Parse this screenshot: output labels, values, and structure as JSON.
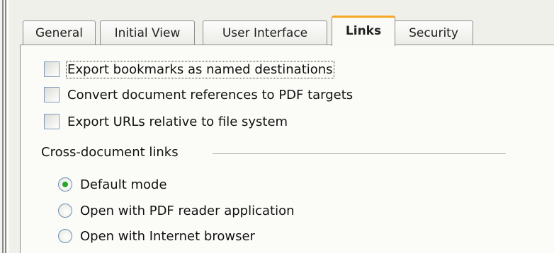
{
  "tabs": [
    {
      "label": "General",
      "active": false
    },
    {
      "label": "Initial View",
      "active": false
    },
    {
      "label": "User Interface",
      "active": false
    },
    {
      "label": "Links",
      "active": true
    },
    {
      "label": "Security",
      "active": false
    }
  ],
  "options": [
    {
      "label": "Export bookmarks as named destinations",
      "checked": false,
      "focused": true
    },
    {
      "label": "Convert document references to PDF targets",
      "checked": false
    },
    {
      "label": "Export URLs relative to file system",
      "checked": false
    }
  ],
  "cross_document_links": {
    "title": "Cross-document links",
    "choices": [
      {
        "label": "Default mode",
        "selected": true
      },
      {
        "label": "Open with PDF reader application",
        "selected": false
      },
      {
        "label": "Open with Internet browser",
        "selected": false
      }
    ]
  },
  "colors": {
    "active_tab_accent": "#f5a623",
    "radio_dot": "#2aa52a"
  }
}
